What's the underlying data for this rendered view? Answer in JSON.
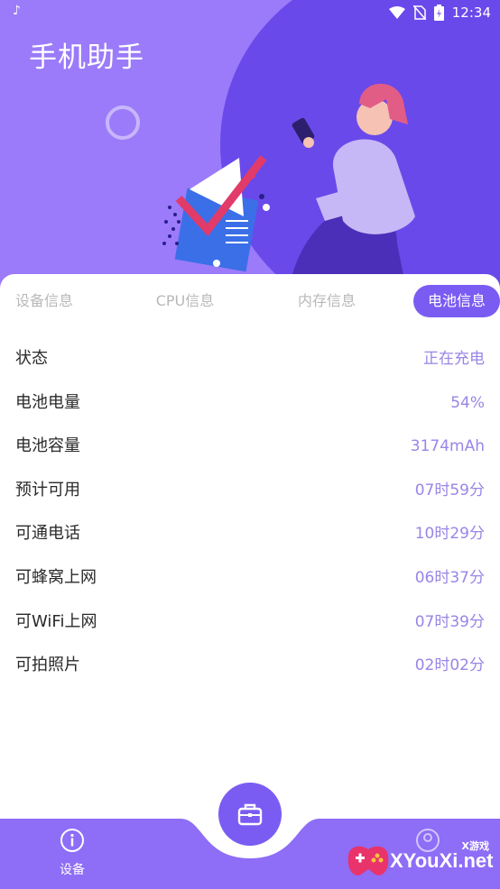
{
  "status_bar": {
    "time": "12:34",
    "icons": [
      "tiktok-icon",
      "wifi-icon",
      "no-sim-icon",
      "battery-charging-icon"
    ]
  },
  "app": {
    "title": "手机助手"
  },
  "tabs": [
    {
      "label": "设备信息",
      "active": false
    },
    {
      "label": "CPU信息",
      "active": false
    },
    {
      "label": "内存信息",
      "active": false
    },
    {
      "label": "电池信息",
      "active": true
    }
  ],
  "battery_info": [
    {
      "label": "状态",
      "value": "正在充电"
    },
    {
      "label": "电池电量",
      "value": "54%"
    },
    {
      "label": "电池容量",
      "value": "3174mAh"
    },
    {
      "label": "预计可用",
      "value": "07时59分"
    },
    {
      "label": "可通电话",
      "value": "10时29分"
    },
    {
      "label": "可蜂窝上网",
      "value": "06时37分"
    },
    {
      "label": "可WiFi上网",
      "value": "07时39分"
    },
    {
      "label": "可拍照片",
      "value": "02时02分"
    }
  ],
  "bottom_nav": {
    "device_label": "设备",
    "center_icon": "briefcase-icon",
    "right_icon": "user-icon"
  },
  "watermark": {
    "small": "X游戏",
    "text": "XYouXi.net"
  },
  "colors": {
    "header_bg": "#9b7bf9",
    "header_circle": "#6a49ea",
    "accent": "#7b5cf2",
    "value_text": "#9a85e6",
    "inactive_tab": "#b8b8b8"
  }
}
